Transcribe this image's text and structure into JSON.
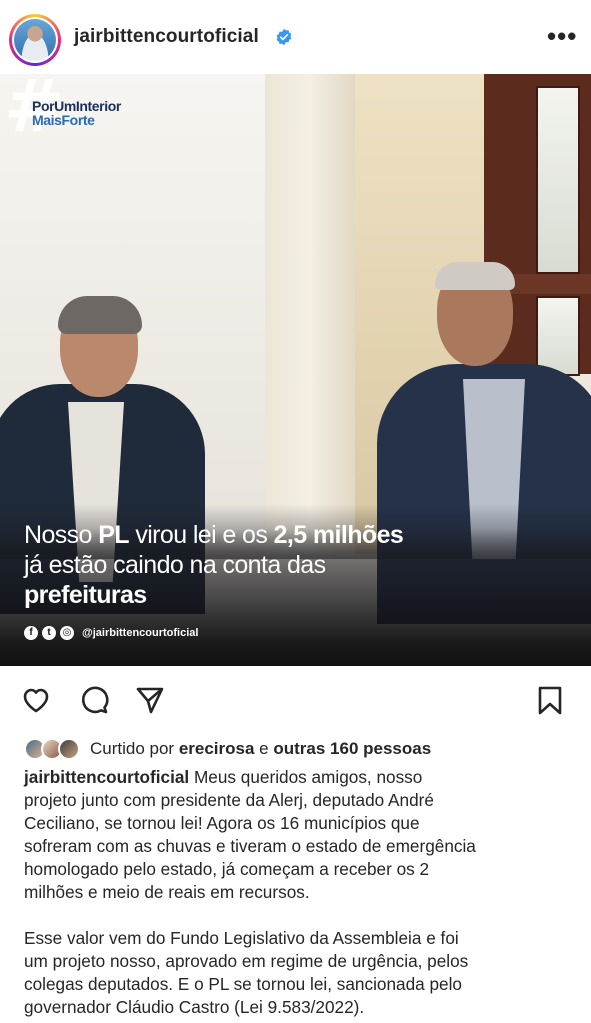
{
  "header": {
    "username": "jairbittencourtoficial",
    "more_label": "•••"
  },
  "post_image": {
    "hashtag_symbol": "#",
    "hashtag_line1": "PorUmInterior",
    "hashtag_line2": "MaisForte",
    "headline": {
      "l1a": "Nosso ",
      "l1b": "PL",
      "l1c": " virou lei e os ",
      "l1d": "2,5 milhões",
      "l2": "já estão caindo na conta das",
      "l3": "prefeituras"
    },
    "social_icons": [
      "f",
      "t",
      "◎"
    ],
    "social_handle": "@jairbittencourtoficial"
  },
  "likes": {
    "prefix": "Curtido por ",
    "user": "erecirosa",
    "middle": " e ",
    "others": "outras 160 pessoas"
  },
  "caption": {
    "username": "jairbittencourtoficial",
    "p1": [
      " Meus queridos amigos, nosso",
      "projeto junto com presidente da Alerj, deputado André",
      "Ceciliano, se tornou lei! Agora os 16 municípios que",
      "sofreram com as chuvas e tiveram o estado de emergência",
      "homologado pelo estado, já começam a receber os 2",
      "milhões e meio de reais em recursos."
    ],
    "p2": [
      "Esse valor vem do Fundo Legislativo da Assembleia e foi",
      "um projeto nosso, aprovado em regime de urgência, pelos",
      "colegas deputados. E o PL se tornou lei, sancionada pelo",
      "governador Cláudio Castro (Lei 9.583/2022)."
    ]
  },
  "colors": {
    "verified": "#3897f0",
    "text": "#262626",
    "hashtag_dark": "#1b2f5c",
    "hashtag_light": "#2b6ab8"
  }
}
